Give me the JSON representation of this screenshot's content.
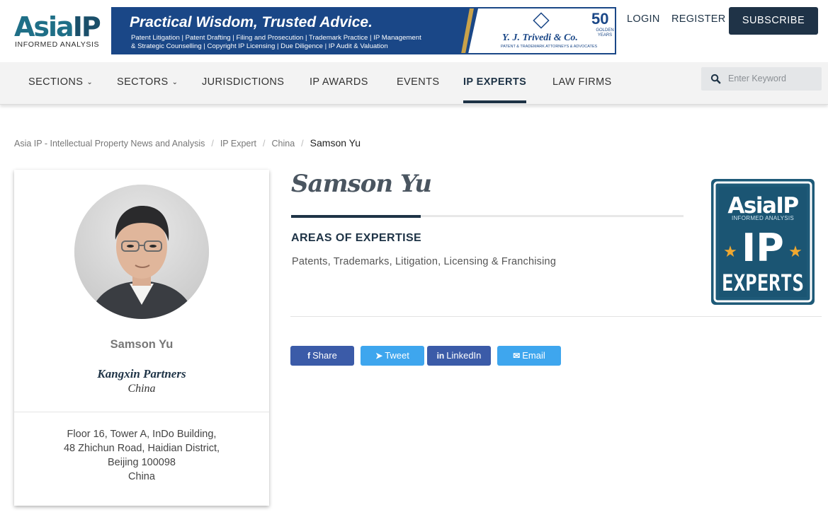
{
  "header": {
    "logo_main": "Asia",
    "logo_ip": "IP",
    "logo_sub": "INFORMED ANALYSIS",
    "banner": {
      "title": "Practical Wisdom, Trusted Advice.",
      "line1": "Patent Litigation  |  Patent Drafting  |  Filing and Prosecution  |  Trademark Practice  |  IP Management",
      "line2": "& Strategic Counselling  |  Copyright IP Licensing  |  Due Diligence  |  IP Audit & Valuation",
      "firm_name": "Y. J. Trivedi & Co.",
      "firm_tag": "PATENT & TRADEMARK ATTORNEYS & ADVOCATES",
      "anniversary_number": "50",
      "anniversary_text": "GOLDEN YEARS"
    },
    "login": "LOGIN",
    "register": "REGISTER",
    "subscribe": "SUBSCRIBE"
  },
  "nav": {
    "items": [
      {
        "label": "SECTIONS",
        "has_dropdown": true
      },
      {
        "label": "SECTORS",
        "has_dropdown": true
      },
      {
        "label": "JURISDICTIONS"
      },
      {
        "label": "IP AWARDS"
      },
      {
        "label": "EVENTS"
      },
      {
        "label": "IP EXPERTS",
        "active": true
      },
      {
        "label": "LAW FIRMS"
      }
    ],
    "search_placeholder": "Enter Keyword"
  },
  "breadcrumb": {
    "items": [
      "Asia IP - Intellectual Property News and Analysis",
      "IP Expert",
      "China"
    ],
    "current": "Samson Yu"
  },
  "profile": {
    "name": "Samson Yu",
    "firm": "Kangxin Partners",
    "country": "China",
    "address": [
      "Floor 16, Tower A, InDo Building,",
      "48 Zhichun Road, Haidian District,",
      "Beijing 100098",
      "China"
    ]
  },
  "main": {
    "name": "Samson Yu",
    "expertise_heading": "AREAS OF EXPERTISE",
    "expertise": "Patents, Trademarks, Litigation, Licensing & Franchising",
    "badge": {
      "line1": "AsiaIP",
      "line2": "INFORMED ANALYSIS",
      "line3": "IP",
      "line4": "EXPERTS"
    }
  },
  "share": {
    "facebook": "Share",
    "twitter": "Tweet",
    "linkedin": "LinkedIn",
    "email": "Email"
  },
  "colors": {
    "navy": "#1e3346",
    "logo_teal": "#1f6f87",
    "banner_blue": "#1a4787",
    "facebook": "#3b5ba8",
    "twitter": "#3ea6ee"
  }
}
